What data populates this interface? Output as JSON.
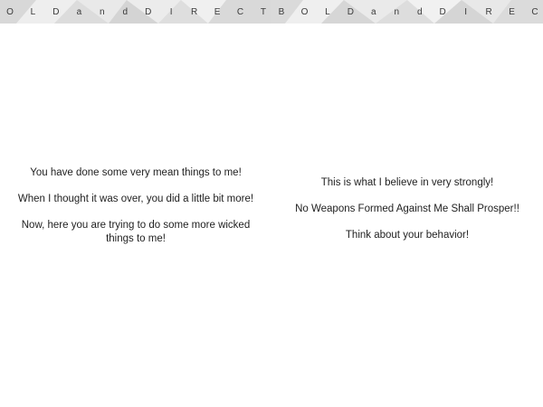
{
  "pages": [
    {
      "header_text": "OLD and DIRECT",
      "paragraphs": [
        "You have done some very mean things to me!",
        "When I thought it was over, you did a little bit more!",
        "Now, here you are trying to do some more wicked things to me!"
      ]
    },
    {
      "header_text": "BOLD and DIREC",
      "paragraphs": [
        "This is what I believe in very strongly!",
        "No Weapons Formed Against Me Shall Prosper!!",
        "Think about your behavior!"
      ]
    }
  ]
}
